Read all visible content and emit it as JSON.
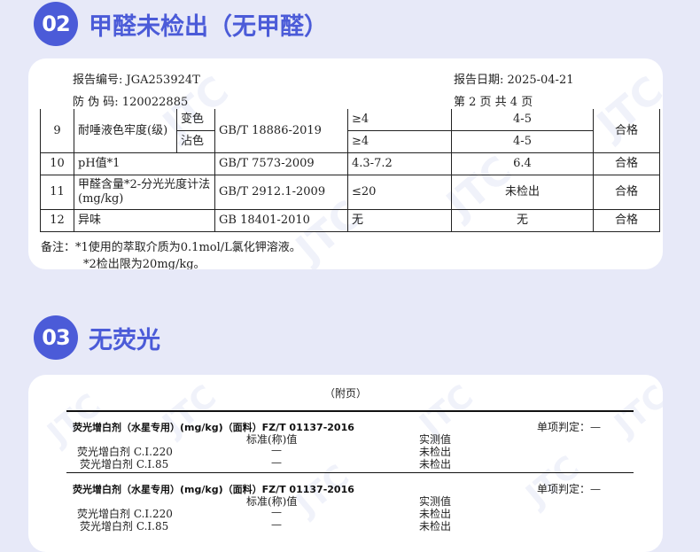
{
  "sections": [
    {
      "number": "02",
      "title": "甲醛未检出（无甲醛）"
    },
    {
      "number": "03",
      "title": "无荧光"
    }
  ],
  "report": {
    "report_no_label": "报告编号:",
    "report_no": "JGA253924T",
    "anticounterfeit_label": "防 伪 码:",
    "anticounterfeit": "120022885",
    "date_label": "报告日期:",
    "date": "2025-04-21",
    "page_info": "第 2 页   共 4 页",
    "rows": [
      {
        "no": "9",
        "item": "耐唾液色牢度(级)",
        "sub1": "变色",
        "sub2": "沾色",
        "std": "GB/T 18886-2019",
        "req1": "≥4",
        "req2": "≥4",
        "res1": "4-5",
        "res2": "4-5",
        "judge": "合格"
      },
      {
        "no": "10",
        "item": "pH值*1",
        "std": "GB/T 7573-2009",
        "req": "4.3-7.2",
        "res": "6.4",
        "judge": "合格"
      },
      {
        "no": "11",
        "item": "甲醛含量*2-分光光度计法(mg/kg)",
        "std": "GB/T 2912.1-2009",
        "req": "≤20",
        "res": "未检出",
        "judge": "合格"
      },
      {
        "no": "12",
        "item": "异味",
        "std": "GB 18401-2010",
        "req": "无",
        "res": "无",
        "judge": "合格"
      }
    ],
    "notes": [
      "备注：*1使用的萃取介质为0.1mol/L氯化钾溶液。",
      "*2检出限为20mg/kg。"
    ]
  },
  "appendix": {
    "label": "（附页）",
    "blocks": [
      {
        "title": "荧光增白剂（水星专用）(mg/kg)（面料）FZ/T 01137-2016",
        "judge": "单项判定：—",
        "std_header": "标准(称)值",
        "res_header": "实测值",
        "items": [
          {
            "name": "荧光增白剂 C.I.220",
            "std": "—",
            "res": "未检出"
          },
          {
            "name": "荧光增白剂 C.I.85",
            "std": "—",
            "res": "未检出"
          }
        ]
      },
      {
        "title": "荧光增白剂（水星专用）(mg/kg)（面料）FZ/T 01137-2016",
        "judge": "单项判定：—",
        "std_header": "标准(称)值",
        "res_header": "实测值",
        "items": [
          {
            "name": "荧光增白剂 C.I.220",
            "std": "—",
            "res": "未检出"
          },
          {
            "name": "荧光增白剂 C.I.85",
            "std": "—",
            "res": "未检出"
          }
        ]
      }
    ]
  },
  "watermark_text": "JTC",
  "colors": {
    "accent": "#4b5bd8",
    "background": "#e7e9f8"
  }
}
